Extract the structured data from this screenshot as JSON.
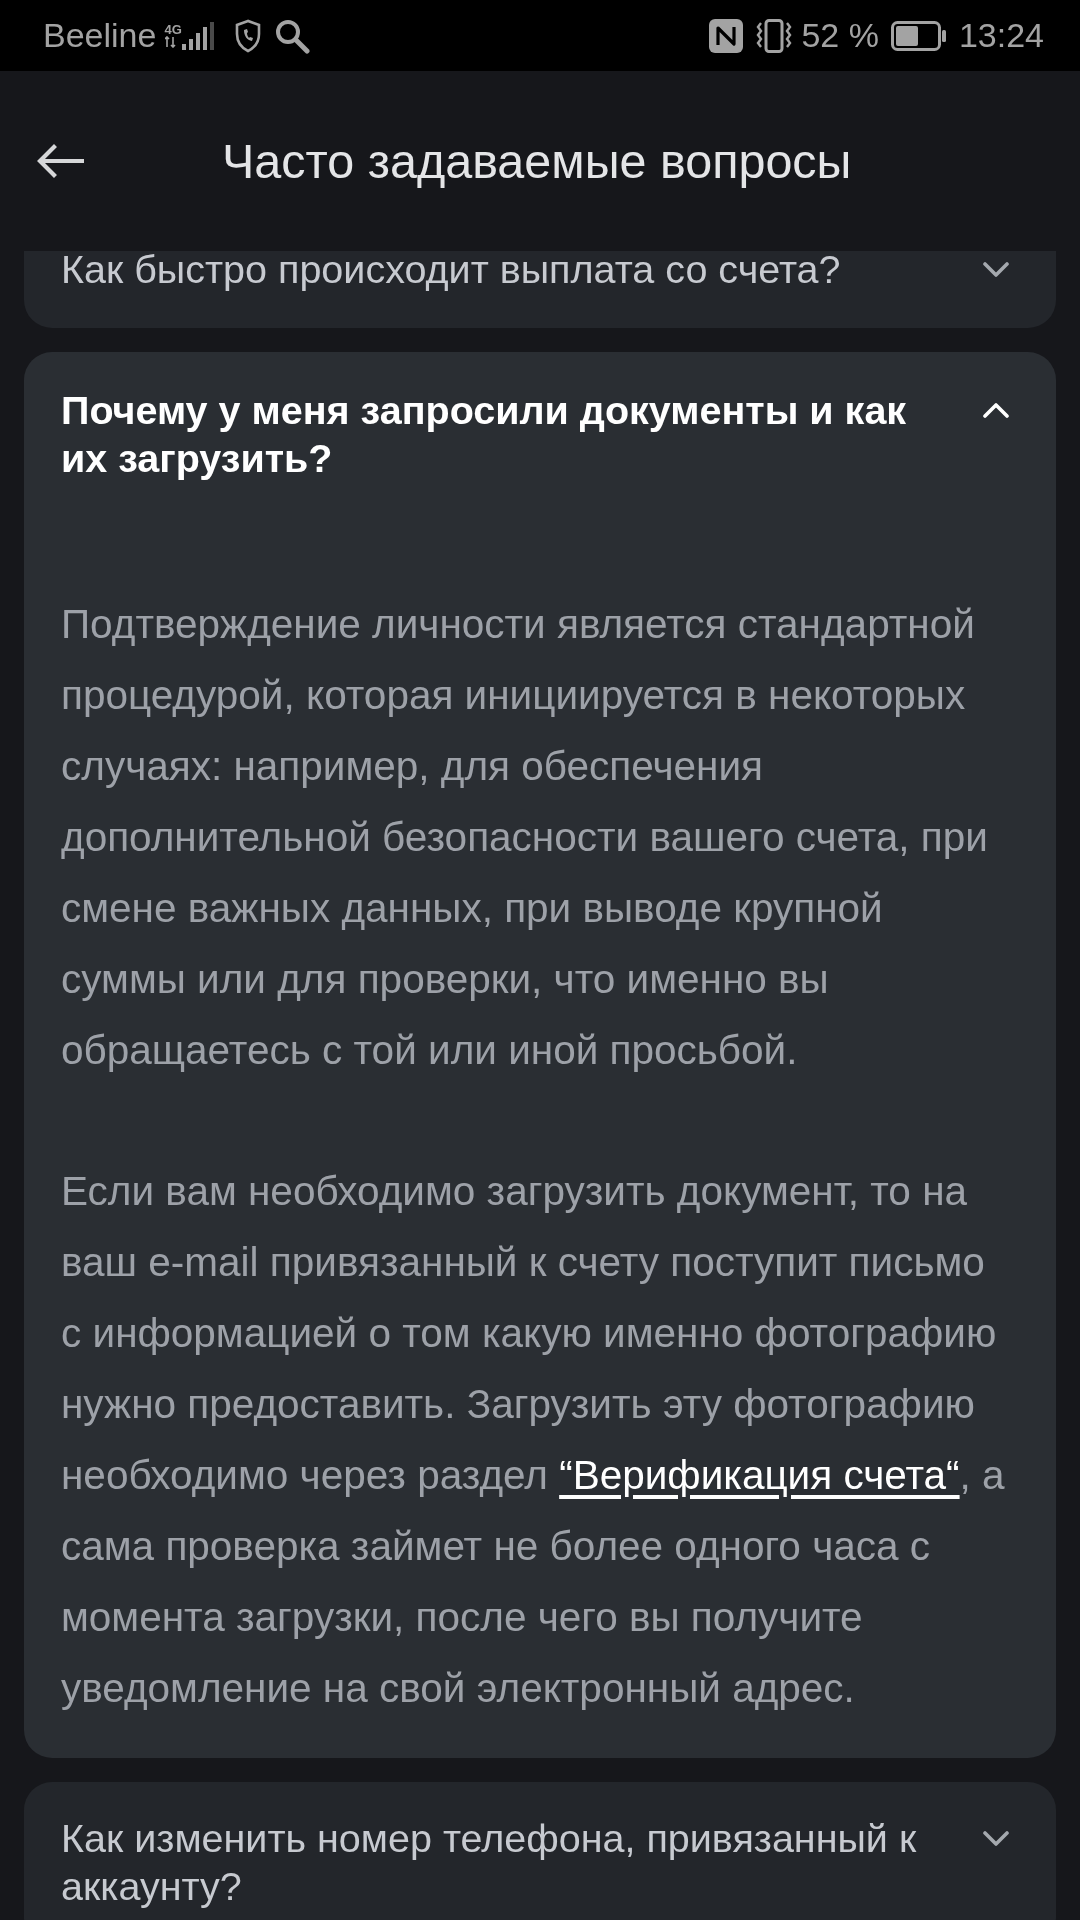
{
  "status_bar": {
    "carrier": "Beeline",
    "network": "4G",
    "battery": "52 %",
    "time": "13:24"
  },
  "app_bar": {
    "title": "Часто задаваемые вопросы"
  },
  "faq": [
    {
      "question": "Как быстро происходит выплата со счета?",
      "expanded": false
    },
    {
      "question": "Почему у меня запросили документы и как их загрузить?",
      "expanded": true,
      "answer": [
        {
          "parts": [
            {
              "kind": "text",
              "text": "Подтверждение личности является стандартной процедурой, которая инициируется в некоторых случаях: например, для обеспечения дополнительной безопасности вашего счета, при смене важных данных, при выводе крупной суммы или для проверки, что именно вы обращаетесь с той или иной просьбой."
            }
          ]
        },
        {
          "parts": [
            {
              "kind": "text",
              "text": "Если вам необходимо загрузить документ, то на ваш e-mail привязанный к счету поступит письмо с информацией о том какую именно фотографию нужно предоставить. Загрузить эту фотографию необходимо через раздел "
            },
            {
              "kind": "link",
              "text": "“Верификация счета“"
            },
            {
              "kind": "text",
              "text": ", а сама проверка займет не более одного часа с момента загрузки, после чего вы получите уведомление на свой электронный адрес."
            }
          ]
        }
      ]
    },
    {
      "question": "Как изменить номер телефона, привязанный к аккаунту?",
      "expanded": false
    }
  ]
}
